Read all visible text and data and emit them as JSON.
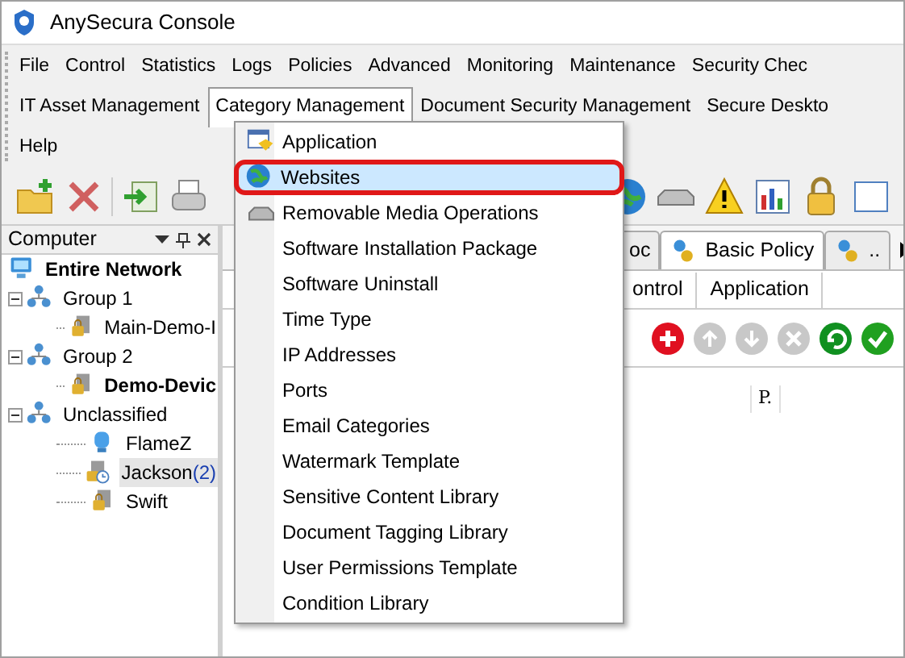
{
  "window": {
    "title": "AnySecura Console"
  },
  "menubar": {
    "items": [
      {
        "label": "File",
        "selected": false
      },
      {
        "label": "Control",
        "selected": false
      },
      {
        "label": "Statistics",
        "selected": false
      },
      {
        "label": "Logs",
        "selected": false
      },
      {
        "label": "Policies",
        "selected": false
      },
      {
        "label": "Advanced",
        "selected": false
      },
      {
        "label": "Monitoring",
        "selected": false
      },
      {
        "label": "Maintenance",
        "selected": false
      },
      {
        "label": "Security Chec",
        "selected": false
      },
      {
        "label": "IT Asset Management",
        "selected": false
      },
      {
        "label": "Category Management",
        "selected": true
      },
      {
        "label": "Document Security Management",
        "selected": false
      },
      {
        "label": "Secure Deskto",
        "selected": false
      },
      {
        "label": "Help",
        "selected": false
      }
    ]
  },
  "dropdown": {
    "items": [
      {
        "label": "Application",
        "selected": false
      },
      {
        "label": "Websites",
        "selected": true
      },
      {
        "label": "Removable Media Operations",
        "selected": false
      },
      {
        "label": "Software Installation Package",
        "selected": false
      },
      {
        "label": "Software Uninstall",
        "selected": false
      },
      {
        "label": "Time Type",
        "selected": false
      },
      {
        "label": "IP Addresses",
        "selected": false
      },
      {
        "label": "Ports",
        "selected": false
      },
      {
        "label": "Email Categories",
        "selected": false
      },
      {
        "label": "Watermark Template",
        "selected": false
      },
      {
        "label": "Sensitive Content Library",
        "selected": false
      },
      {
        "label": "Document Tagging Library",
        "selected": false
      },
      {
        "label": "User Permissions Template",
        "selected": false
      },
      {
        "label": "Condition Library",
        "selected": false
      }
    ]
  },
  "computer_panel": {
    "title": "Computer",
    "tree": [
      {
        "label": "Entire Network",
        "kind": "network",
        "bold": true,
        "selected": false,
        "children": [
          {
            "label": "Group 1",
            "kind": "group",
            "bold": false,
            "selected": false,
            "expanded": true,
            "children": [
              {
                "label": "Main-Demo-I",
                "kind": "locked",
                "bold": false,
                "selected": false
              }
            ]
          },
          {
            "label": "Group 2",
            "kind": "group",
            "bold": false,
            "selected": false,
            "expanded": true,
            "children": [
              {
                "label": "Demo-Devic",
                "kind": "locked",
                "bold": true,
                "selected": false
              }
            ]
          },
          {
            "label": "Unclassified",
            "kind": "group",
            "bold": false,
            "selected": false,
            "expanded": true,
            "children": [
              {
                "label": "FlameZ",
                "kind": "computer",
                "bold": false,
                "selected": false
              },
              {
                "label": "Jackson",
                "count": "(2)",
                "kind": "clock",
                "bold": false,
                "selected": true
              },
              {
                "label": "Swift",
                "kind": "locked",
                "bold": false,
                "selected": false
              }
            ]
          }
        ]
      }
    ]
  },
  "policy_tabs": [
    {
      "label": "oc",
      "selected": false
    },
    {
      "label": "Basic Policy",
      "selected": true
    },
    {
      "label": "..",
      "selected": false
    }
  ],
  "sub_tabs": [
    {
      "label": "ontrol",
      "selected": false
    },
    {
      "label": "Application",
      "selected": false
    }
  ],
  "actions": [
    {
      "disabled": false
    },
    {
      "disabled": true
    },
    {
      "disabled": true
    },
    {
      "disabled": true
    },
    {
      "disabled": false
    },
    {
      "disabled": false
    }
  ],
  "table": {
    "columns": [
      "P."
    ]
  }
}
